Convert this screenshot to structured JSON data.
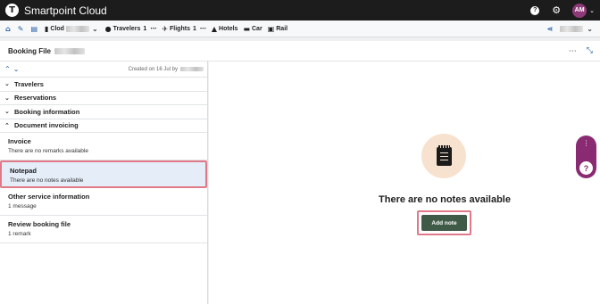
{
  "app": {
    "logo_letter": "T",
    "title": "Smartpoint Cloud",
    "user_initials": "AM"
  },
  "toolbar": {
    "pnr_label": "Clod",
    "travelers_label": "Travelers",
    "travelers_count": "1",
    "flights_label": "Flights",
    "flights_count": "1",
    "hotels_label": "Hotels",
    "car_label": "Car",
    "rail_label": "Rail",
    "more": "⋯"
  },
  "booking_file": {
    "title": "Booking File",
    "menu": "⋯"
  },
  "left_panel": {
    "created_text": "Created on 16 Jul by",
    "sections": [
      {
        "label": "Travelers",
        "chevron": "⌄"
      },
      {
        "label": "Reservations",
        "chevron": "⌄"
      },
      {
        "label": "Booking information",
        "chevron": "⌄"
      },
      {
        "label": "Document invoicing",
        "chevron": "⌃"
      }
    ],
    "items": [
      {
        "title": "Invoice",
        "subtitle": "There are no remarks available"
      },
      {
        "title": "Notepad",
        "subtitle": "There are no notes available"
      },
      {
        "title": "Other service information",
        "subtitle": "1 message"
      },
      {
        "title": "Review booking file",
        "subtitle": "1 remark"
      }
    ]
  },
  "main": {
    "empty_message": "There are no notes available",
    "add_note_label": "Add note"
  },
  "colors": {
    "brand_purple": "#8a2a73",
    "accent_blue": "#1f5aa6",
    "button_green": "#3f5a46",
    "highlight_pink": "#e07a89"
  }
}
